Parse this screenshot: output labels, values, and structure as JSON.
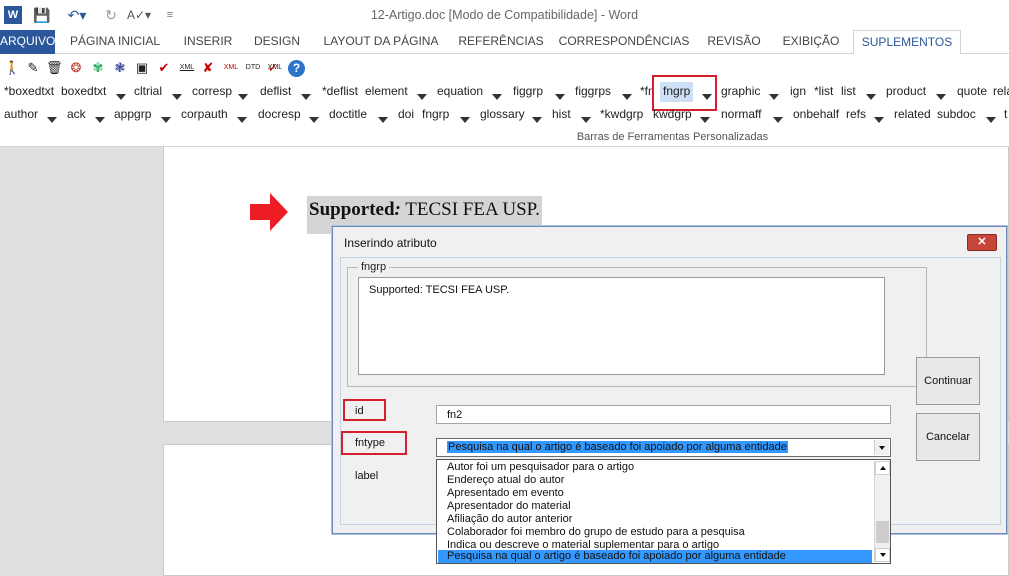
{
  "window": {
    "title": "12-Artigo.doc [Modo de Compatibilidade] - Word"
  },
  "quick_access": [
    {
      "name": "word-logo-icon",
      "glyph": "W"
    },
    {
      "name": "save-icon",
      "glyph": "💾"
    },
    {
      "name": "undo-icon",
      "glyph": "↶▾"
    },
    {
      "name": "redo-icon",
      "glyph": "↻"
    },
    {
      "name": "spelling-icon",
      "glyph": "A✓▾"
    },
    {
      "name": "customize-icon",
      "glyph": "≡"
    }
  ],
  "tabs": [
    {
      "label": "ARQUIVO"
    },
    {
      "label": "PÁGINA INICIAL"
    },
    {
      "label": "INSERIR"
    },
    {
      "label": "DESIGN"
    },
    {
      "label": "LAYOUT DA PÁGINA"
    },
    {
      "label": "REFERÊNCIAS"
    },
    {
      "label": "CORRESPONDÊNCIAS"
    },
    {
      "label": "REVISÃO"
    },
    {
      "label": "EXIBIÇÃO"
    },
    {
      "label": "SUPLEMENTOS"
    }
  ],
  "toolbar_icons": [
    {
      "name": "person-icon",
      "glyph": "🚶"
    },
    {
      "name": "pencil-icon",
      "glyph": "✎"
    },
    {
      "name": "trash-icon",
      "glyph": "🗑"
    },
    {
      "name": "group-icon",
      "glyph": "❂"
    },
    {
      "name": "colors-icon",
      "glyph": "✾"
    },
    {
      "name": "users-icon",
      "glyph": "❃"
    },
    {
      "name": "save-disk-icon",
      "glyph": "▣"
    },
    {
      "name": "check-icon",
      "glyph": "✔"
    },
    {
      "name": "xml-icon",
      "glyph": "XML"
    },
    {
      "name": "x-icon",
      "glyph": "✘"
    },
    {
      "name": "xml-check-icon",
      "glyph": "XML"
    },
    {
      "name": "dtd-icon",
      "glyph": "DTD"
    },
    {
      "name": "spell-xml-icon",
      "glyph": "✓"
    },
    {
      "name": "xml-report-icon",
      "glyph": "XML"
    },
    {
      "name": "help-icon",
      "glyph": "?"
    }
  ],
  "ribbon_row1": [
    "*boxedtxt",
    "boxedtxt",
    "▼",
    "cltrial",
    "▼",
    "corresp",
    "▼",
    "deflist",
    "▼",
    "*deflist",
    "element",
    "▼",
    "equation",
    "▼",
    "figgrp",
    "▼",
    "figgrps",
    "▼",
    "*fn",
    "fngrp",
    "▼",
    "graphic",
    "▼",
    "ign",
    "*list",
    "list",
    "▼",
    "product",
    "▼",
    "quote",
    "related"
  ],
  "ribbon_row2": [
    "author",
    "▼",
    "ack",
    "▼",
    "appgrp",
    "▼",
    "corpauth",
    "▼",
    "docresp",
    "▼",
    "doctitle",
    "▼",
    "doi",
    "fngrp",
    "▼",
    "glossary",
    "▼",
    "hist",
    "▼",
    "*kwdgrp",
    "kwdgrp",
    "▼",
    "normaff",
    "▼",
    "onbehalf",
    "refs",
    "▼",
    "related",
    "subdoc",
    "▼",
    "t"
  ],
  "ribbon_group_label": "Barras de Ferramentas Personalizadas",
  "document": {
    "supported_label": "Supported",
    "supported_colon": ":",
    "supported_text": " TECSI FEA USP."
  },
  "dialog": {
    "title": "Inserindo atributo",
    "close_label": "✕",
    "group_label": "fngrp",
    "text_value": "Supported: TECSI FEA USP.",
    "id_label": "id",
    "id_value": "fn2",
    "fntype_label": "fntype",
    "fntype_value": "Pesquisa na qual o artigo é baseado foi apoiado por alguma entidade",
    "label_label": "label",
    "continue_label": "Continuar",
    "cancel_label": "Cancelar",
    "options": [
      "Autor foi um pesquisador para o artigo",
      "Endereço atual do autor",
      "Apresentado em evento",
      "Apresentador do material",
      "Afiliação do autor anterior",
      "Colaborador foi membro do grupo de estudo para a pesquisa",
      "Indica ou descreve o material suplementar para o artigo",
      "Pesquisa na qual o artigo é baseado foi apoiado por alguma entidade"
    ],
    "selected_option_index": 7
  },
  "colors": {
    "accent": "#2b579a",
    "highlight": "#d4202c",
    "selection": "#3399ff"
  }
}
